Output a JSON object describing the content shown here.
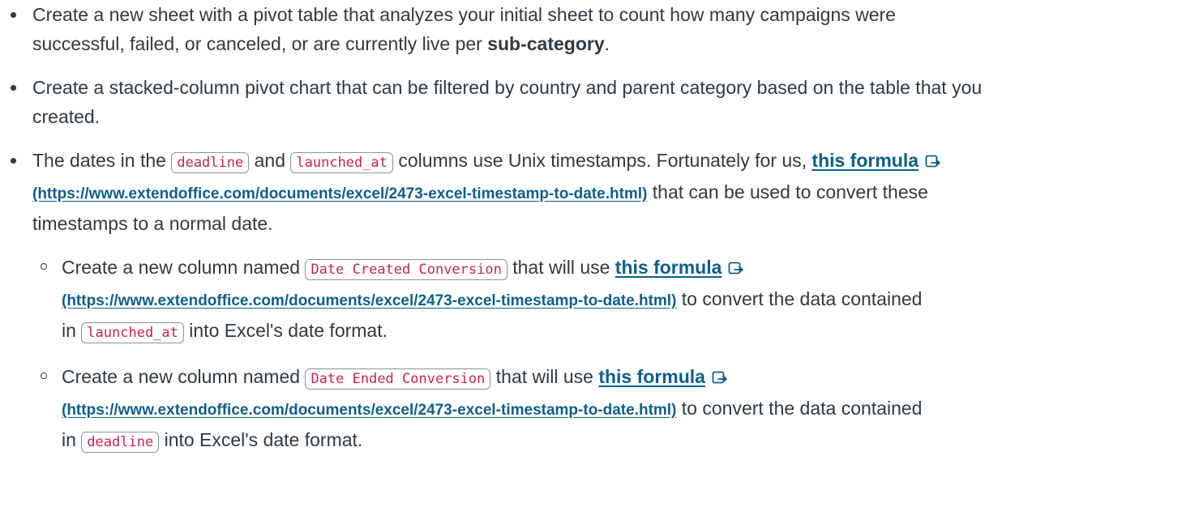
{
  "items": [
    {
      "line1": "Create a new sheet with a pivot table that analyzes your initial sheet to count how many campaigns were",
      "line2_prefix": "successful, failed, or canceled, or are currently live per ",
      "line2_bold": "sub-category",
      "line2_suffix": "."
    },
    {
      "line1": "Create a stacked-column pivot chart that can be filtered by country and parent category based on the table that you",
      "line2": "created."
    },
    {
      "line1_prefix": "The dates in the ",
      "code1": "deadline",
      "line1_mid": " and ",
      "code2": "launched_at",
      "line1_after": " columns use Unix timestamps. Fortunately for us, ",
      "link_text": "this formula",
      "link_url": "(https://www.extendoffice.com/documents/excel/2473-excel-timestamp-to-date.html)",
      "line2_after": " that can be used to convert these",
      "line3": "timestamps to a normal date.",
      "subitems": [
        {
          "prefix": "Create a new column named ",
          "code": "Date Created Conversion",
          "mid": " that will use ",
          "link_text": "this formula",
          "link_url": "(https://www.extendoffice.com/documents/excel/2473-excel-timestamp-to-date.html)",
          "after_url": " to convert the data contained",
          "line3_prefix": "in ",
          "code2": "launched_at",
          "line3_suffix": " into Excel's date format."
        },
        {
          "prefix": "Create a new column named ",
          "code": "Date Ended Conversion",
          "mid": " that will use ",
          "link_text": "this formula",
          "link_url": "(https://www.extendoffice.com/documents/excel/2473-excel-timestamp-to-date.html)",
          "after_url": " to convert the data contained",
          "line3_prefix": "in ",
          "code2": "deadline",
          "line3_suffix": " into Excel's date format."
        }
      ]
    }
  ],
  "icons": {
    "external_link": "external-link-icon"
  },
  "colors": {
    "text": "#2d3b45",
    "link": "#0d5f8c",
    "code": "#c7254e"
  }
}
